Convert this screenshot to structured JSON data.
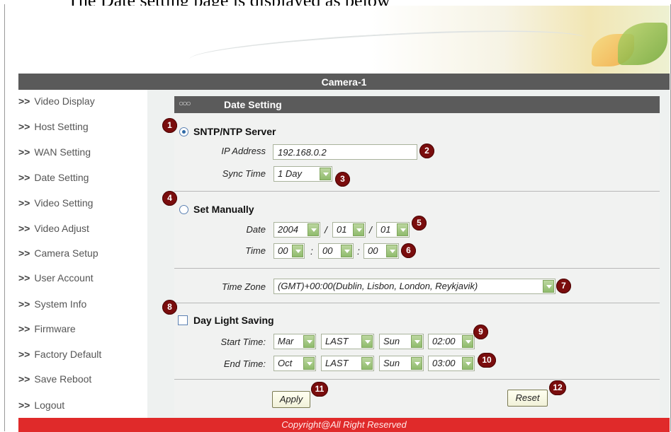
{
  "caption": "The Date setting page is displayed as below",
  "window": {
    "title": "Camera-1"
  },
  "sidebar": {
    "items": [
      {
        "prefix": ">>",
        "label": "Video Display"
      },
      {
        "prefix": ">>",
        "label": "Host Setting"
      },
      {
        "prefix": ">>",
        "label": "WAN Setting"
      },
      {
        "prefix": ">>",
        "label": "Date Setting"
      },
      {
        "prefix": ">>",
        "label": "Video Setting"
      },
      {
        "prefix": ">>",
        "label": "Video Adjust"
      },
      {
        "prefix": ">>",
        "label": "Camera Setup"
      },
      {
        "prefix": ">>",
        "label": "User Account"
      },
      {
        "prefix": ">>",
        "label": "System Info"
      },
      {
        "prefix": ">>",
        "label": "Firmware"
      },
      {
        "prefix": ">>",
        "label": "Factory Default"
      },
      {
        "prefix": ">>",
        "label": "Save Reboot"
      },
      {
        "prefix": ">>",
        "label": "Logout"
      }
    ]
  },
  "panel": {
    "title": "Date Setting",
    "rings": "○○○"
  },
  "sntp": {
    "label": "SNTP/NTP Server",
    "selected": true,
    "ip_label": "IP Address",
    "ip_value": "192.168.0.2",
    "sync_label": "Sync Time",
    "sync_value": "1 Day"
  },
  "manual": {
    "label": "Set Manually",
    "selected": false,
    "date_label": "Date",
    "year": "2004",
    "month": "01",
    "day": "01",
    "date_sep": "/",
    "time_label": "Time",
    "hour": "00",
    "minute": "00",
    "second": "00",
    "time_sep": ":"
  },
  "timezone": {
    "label": "Time Zone",
    "value": "(GMT)+00:00(Dublin, Lisbon, London, Reykjavik)"
  },
  "dst": {
    "label": "Day Light Saving",
    "checked": false,
    "start_label": "Start Time:",
    "start_month": "Mar",
    "start_week": "LAST",
    "start_day": "Sun",
    "start_time": "02:00",
    "end_label": "End Time:",
    "end_month": "Oct",
    "end_week": "LAST",
    "end_day": "Sun",
    "end_time": "03:00"
  },
  "buttons": {
    "apply": "Apply",
    "reset": "Reset"
  },
  "badges": [
    "1",
    "2",
    "3",
    "4",
    "5",
    "6",
    "7",
    "8",
    "9",
    "10",
    "11",
    "12"
  ],
  "footer": "Copyright@All Right Reserved",
  "colors": {
    "header_bar": "#5a5a5a",
    "footer_bar": "#e02a2a",
    "badge": "#7a0d0d",
    "dropdown_button": "#9cc47a"
  }
}
